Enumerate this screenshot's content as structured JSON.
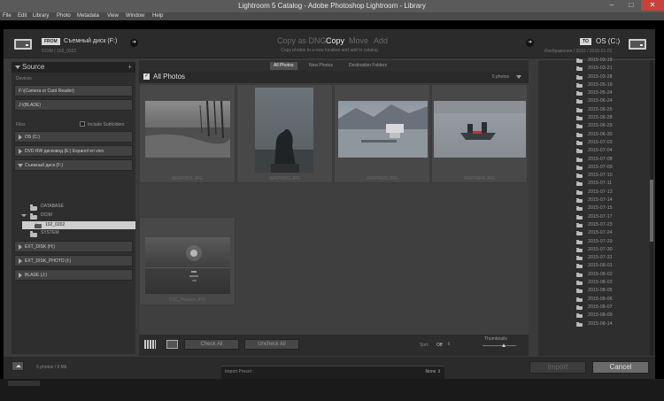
{
  "window": {
    "title": "Lightroom 5 Catalog - Adobe Photoshop Lightroom - Library",
    "minimize": "–",
    "maximize": "□",
    "close": "✕"
  },
  "menu": [
    "File",
    "Edit",
    "Library",
    "Photo",
    "Metadata",
    "View",
    "Window",
    "Help"
  ],
  "import_top": {
    "from_badge": "FROM",
    "source_name": "Съемный диск (F:)",
    "source_path": "DCIM / 102_0202",
    "modes": [
      "Copy as DNG",
      "Copy",
      "Move",
      "Add"
    ],
    "active_mode": "Copy",
    "mode_description": "Copy photos to a new location and add to catalog",
    "to_badge": "TO",
    "dest_name": "OS (C:)",
    "dest_path": "Изображения / 2015 / 2015-01-01",
    "arrow_glyph": "➜"
  },
  "source_panel": {
    "title": "Source",
    "add": "+",
    "devices_label": "Devices",
    "devices": [
      "F:\\(Camera or Card Reader)",
      "J:\\(BLADE)"
    ],
    "files_label": "Files",
    "include_subfolders": "Include Subfolders",
    "volumes_before": [
      "OS (C:)",
      "DVD RW дисковод (E:) Espanol en vivo"
    ],
    "expanded_volume": "Съемный диск (F:)",
    "tree": {
      "database": "DATABASE",
      "dcim": "DCIM",
      "selected": "102_0202",
      "system": "SYSTEM"
    },
    "volumes_after": [
      "EXT_DISK (H:)",
      "EXT_DISK_PHOTO (I:)",
      "BLADE (J:)"
    ]
  },
  "center": {
    "tabs": [
      "All Photos",
      "New Photos",
      "Destination Folders"
    ],
    "active_tab": "All Photos",
    "header_label": "All Photos",
    "check_glyph": "✓",
    "photo_count": "5 photos",
    "thumbnails": [
      {
        "name": "IMGP0901.JPG"
      },
      {
        "name": "IMGP0902.JPG"
      },
      {
        "name": "IMGP0903.JPG"
      },
      {
        "name": "IMGP0904.JPG"
      },
      {
        "name": "DSC_Horizon.JPG"
      }
    ],
    "check_all": "Check All",
    "uncheck_all": "Uncheck All",
    "sort_label": "Sort:",
    "sort_value": "Off",
    "sort_stepper": "⇕",
    "thumbnails_label": "Thumbnails",
    "thumbnail_size": 0.58
  },
  "dest_folders": [
    "2015-03-19",
    "2015-03-21",
    "2015-03-28",
    "2015-05-19",
    "2015-05-24",
    "2015-06-24",
    "2015-06-25",
    "2015-06-28",
    "2015-06-29",
    "2015-06-30",
    "2015-07-03",
    "2015-07-04",
    "2015-07-08",
    "2015-07-09",
    "2015-07-10",
    "2015-07-11",
    "2015-07-13",
    "2015-07-14",
    "2015-07-15",
    "2015-07-17",
    "2015-07-23",
    "2015-07-24",
    "2015-07-29",
    "2015-07-30",
    "2015-07-31",
    "2015-08-01",
    "2015-08-02",
    "2015-08-03",
    "2015-08-05",
    "2015-08-06",
    "2015-08-07",
    "2015-08-09",
    "2015-08-14"
  ],
  "bottom": {
    "summary": "5 photos / 9 Mb",
    "import_preset_label": "Import Preset :",
    "import_preset_value": "None ⇕",
    "import_button": "Import",
    "cancel_button": "Cancel"
  }
}
